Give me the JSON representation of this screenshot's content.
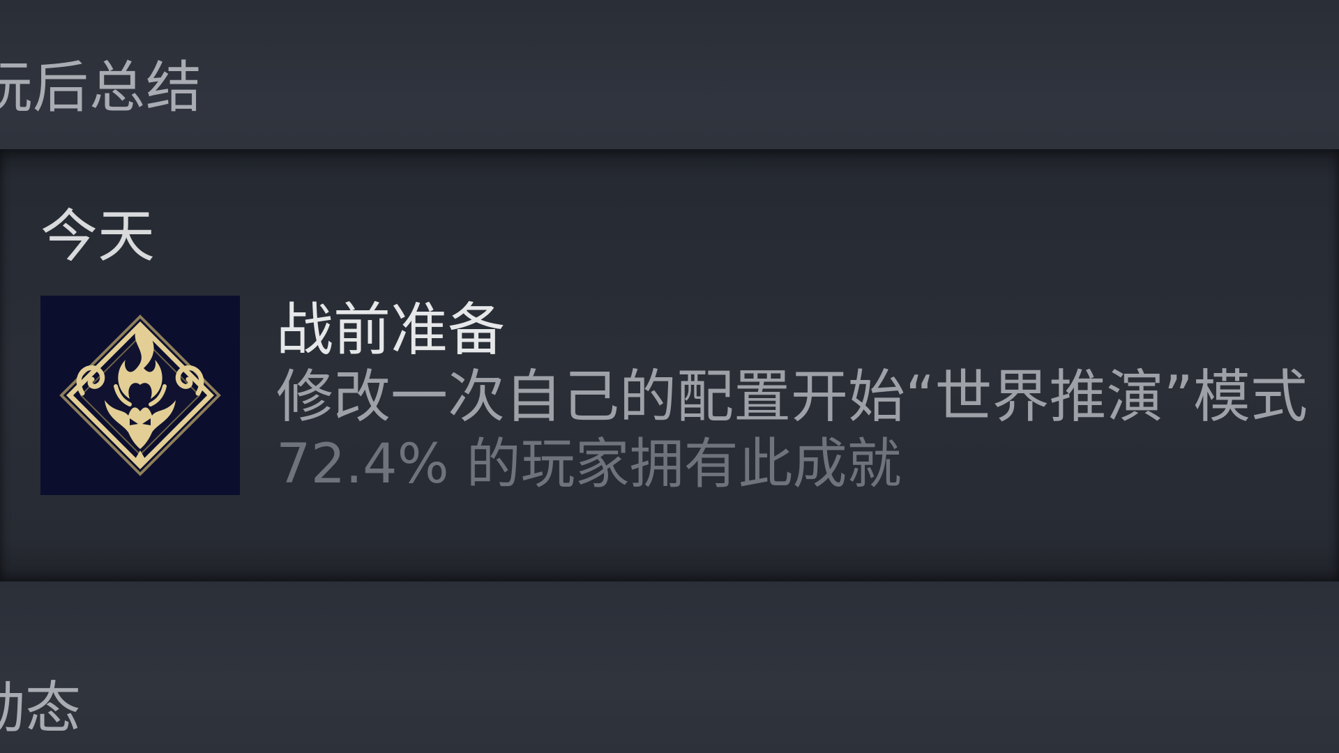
{
  "sections": {
    "top_heading": "玩后总结",
    "bottom_heading": "动态"
  },
  "achievement_panel": {
    "date_label": "今天",
    "achievement": {
      "title": "战前准备",
      "description": "修改一次自己的配置开始“世界推演”模式",
      "unlock_rate_text": "72.4% 的玩家拥有此成就",
      "unlock_rate_percent": 72.4,
      "icon": "flame-diamond-emblem-icon",
      "icon_colors": {
        "background": "#0c0e2e",
        "emblem": "#e3cf95"
      }
    }
  }
}
